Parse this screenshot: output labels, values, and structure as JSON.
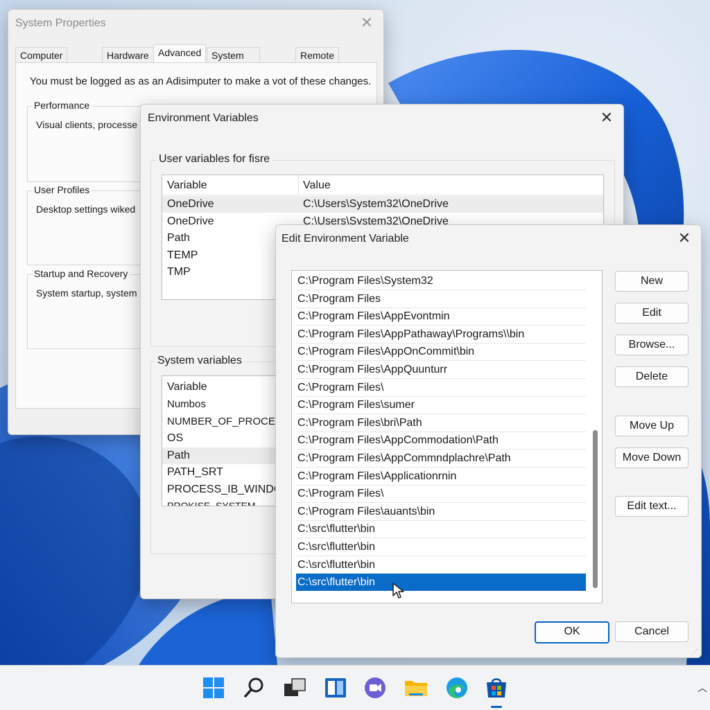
{
  "system_properties": {
    "title": "System Properties",
    "tabs": [
      "Computer Name",
      "Hardware",
      "Advanced",
      "System Protection",
      "Remote"
    ],
    "admin_note": "You must be logged as as an Adisimputer to make a vot of these changes.",
    "performance": {
      "label": "Performance",
      "text": "Visual clients, processe"
    },
    "user_profiles": {
      "label": "User Profiles",
      "text": "Desktop settings wiked"
    },
    "startup_recovery": {
      "label": "Startup and Recovery",
      "text": "System startup, system"
    }
  },
  "env_vars": {
    "title": "Environment Variables",
    "user_section_label": "User variables for fisre",
    "user_columns": [
      "Variable",
      "Value"
    ],
    "user_rows": [
      {
        "variable": "OneDrive",
        "value": "C:\\Users\\System32\\OneDrive"
      },
      {
        "variable": "OneDrive",
        "value": "C:\\Users\\System32\\OneDrive"
      },
      {
        "variable": "Path",
        "value": ""
      },
      {
        "variable": "TEMP",
        "value": ""
      },
      {
        "variable": "TMP",
        "value": ""
      }
    ],
    "system_section_label": "System variables",
    "system_columns": [
      "Variable"
    ],
    "system_rows": [
      "Numbos",
      "NUMBER_OF_PROCESS",
      "OS",
      "Path",
      "PATH_SRT",
      "PROCESS_IB_WINDOW",
      "PROKISE_SYSTEM"
    ]
  },
  "edit_env": {
    "title": "Edit Environment Variable",
    "paths": [
      "C:\\Program Files\\System32",
      "C:\\Program Files",
      "C:\\Program Files\\AppEvontmin",
      "C:\\Program Files\\AppPathaway\\Programs\\\\bin",
      "C:\\Program Files\\AppOnCommit\\bin",
      "C:\\Program Files\\AppQuunturr",
      "C:\\Program Files\\",
      "C:\\Program Files\\sumer",
      "C:\\Program Files\\bri\\Path",
      "C:\\Program Files\\AppCommodation\\Path",
      "C:\\Program Files\\AppCommndplachre\\Path",
      "C:\\Program Files\\Applicationrnin",
      "C:\\Program Files\\",
      "C:\\Program Files\\auants\\bin",
      "C:\\src\\flutter\\bin",
      "C:\\src\\flutter\\bin",
      "C:\\src\\flutter\\bin",
      "C:\\src\\flutter\\bin"
    ],
    "selected_index": 17,
    "buttons": {
      "new": "New",
      "edit": "Edit",
      "browse": "Browse...",
      "delete": "Delete",
      "move_up": "Move Up",
      "move_down": "Move Down",
      "edit_text": "Edit text...",
      "ok": "OK",
      "cancel": "Cancel"
    }
  },
  "taskbar": {
    "icons": [
      "windows-start-icon",
      "search-icon",
      "task-view-icon",
      "widgets-icon",
      "chat-icon",
      "file-explorer-icon",
      "edge-browser-icon",
      "store-icon"
    ],
    "active_icon": "store-icon"
  },
  "colors": {
    "selection": "#0a6cc9",
    "accent": "#0a62c0",
    "wallpaper": "#1a5fd0"
  }
}
